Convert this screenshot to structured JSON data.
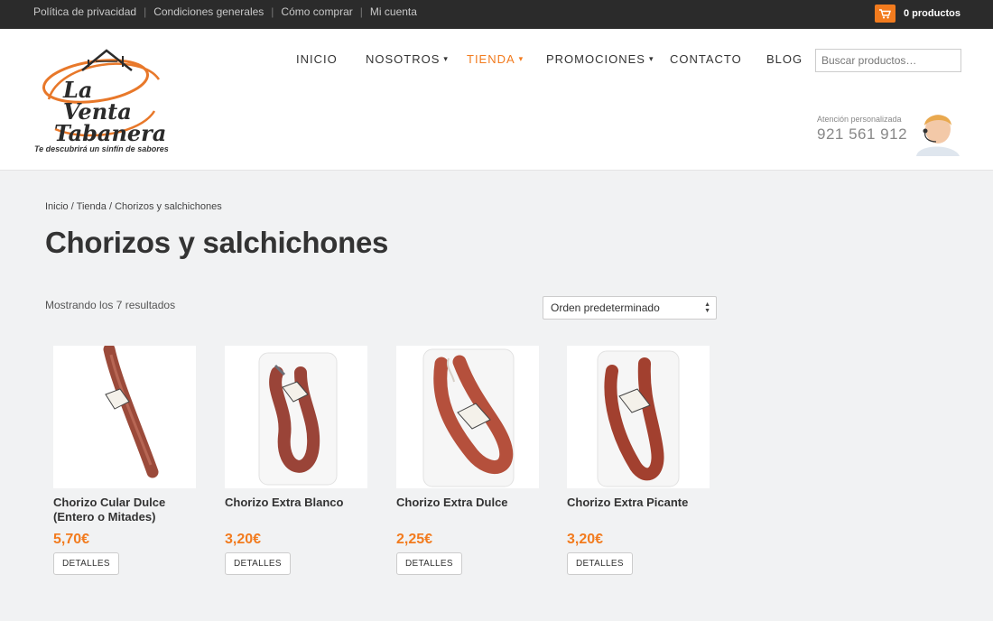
{
  "topbar": {
    "links": [
      "Política de privacidad",
      "Condiciones generales",
      "Cómo comprar",
      "Mi cuenta"
    ],
    "cart_label": "0 productos"
  },
  "header": {
    "logo_text_line1": "La Venta",
    "logo_text_line2": "Tabanera",
    "tagline": "Te descubrirá un sinfín de  sabores",
    "nav": [
      {
        "label": "INICIO",
        "dropdown": false,
        "active": false
      },
      {
        "label": "NOSOTROS",
        "dropdown": true,
        "active": false
      },
      {
        "label": "TIENDA",
        "dropdown": true,
        "active": true
      },
      {
        "label": "PROMOCIONES",
        "dropdown": true,
        "active": false
      },
      {
        "label": "CONTACTO",
        "dropdown": false,
        "active": false
      },
      {
        "label": "BLOG",
        "dropdown": false,
        "active": false
      }
    ],
    "search_placeholder": "Buscar productos…",
    "support_label": "Atención personalizada",
    "support_phone": "921 561 912"
  },
  "breadcrumb": [
    "Inicio",
    "Tienda",
    "Chorizos y salchichones"
  ],
  "page_title": "Chorizos y salchichones",
  "result_count": "Mostrando los 7 resultados",
  "orderby": "Orden predeterminado",
  "products": [
    {
      "name": "Chorizo Cular Dulce (Entero o Mitades)",
      "price": "5,70€",
      "button": "DETALLES"
    },
    {
      "name": "Chorizo Extra Blanco",
      "price": "3,20€",
      "button": "DETALLES"
    },
    {
      "name": "Chorizo Extra Dulce",
      "price": "2,25€",
      "button": "DETALLES"
    },
    {
      "name": "Chorizo Extra Picante",
      "price": "3,20€",
      "button": "DETALLES"
    }
  ],
  "colors": {
    "accent": "#f27b1e",
    "topbar": "#2b2b2b",
    "background": "#f1f2f3"
  }
}
